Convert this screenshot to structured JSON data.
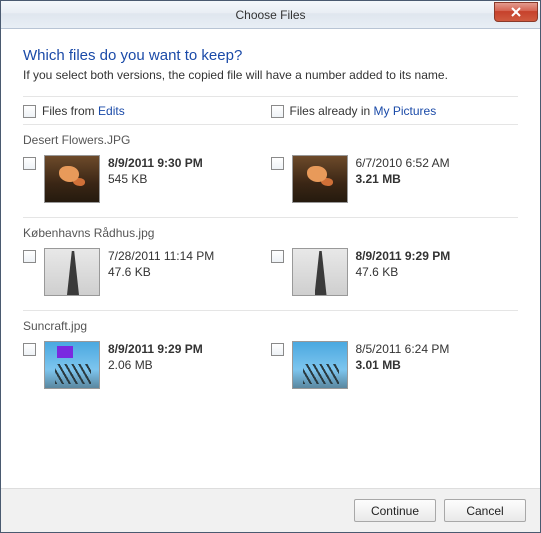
{
  "window": {
    "title": "Choose Files"
  },
  "header": {
    "heading": "Which files do you want to keep?",
    "subtext": "If you select both versions, the copied file will have a number added to its name."
  },
  "columns": {
    "left_prefix": "Files from ",
    "left_link": "Edits",
    "right_prefix": "Files already in ",
    "right_link": "My Pictures"
  },
  "groups": [
    {
      "filename": "Desert Flowers.JPG",
      "thumb_class": "t-desert",
      "left": {
        "date": "8/9/2011 9:30 PM",
        "size": "545 KB",
        "date_bold": true,
        "size_bold": false
      },
      "right": {
        "date": "6/7/2010 6:52 AM",
        "size": "3.21 MB",
        "date_bold": false,
        "size_bold": true
      }
    },
    {
      "filename": "Københavns Rådhus.jpg",
      "thumb_class": "t-tower",
      "left": {
        "date": "7/28/2011 11:14 PM",
        "size": "47.6 KB",
        "date_bold": false,
        "size_bold": false
      },
      "right": {
        "date": "8/9/2011 9:29 PM",
        "size": "47.6 KB",
        "date_bold": true,
        "size_bold": false
      }
    },
    {
      "filename": "Suncraft.jpg",
      "thumb_class": "t-sun",
      "left": {
        "date": "8/9/2011 9:29 PM",
        "size": "2.06 MB",
        "date_bold": true,
        "size_bold": false,
        "edit": true
      },
      "right": {
        "date": "8/5/2011 6:24 PM",
        "size": "3.01 MB",
        "date_bold": false,
        "size_bold": true
      }
    }
  ],
  "footer": {
    "continue": "Continue",
    "cancel": "Cancel"
  }
}
